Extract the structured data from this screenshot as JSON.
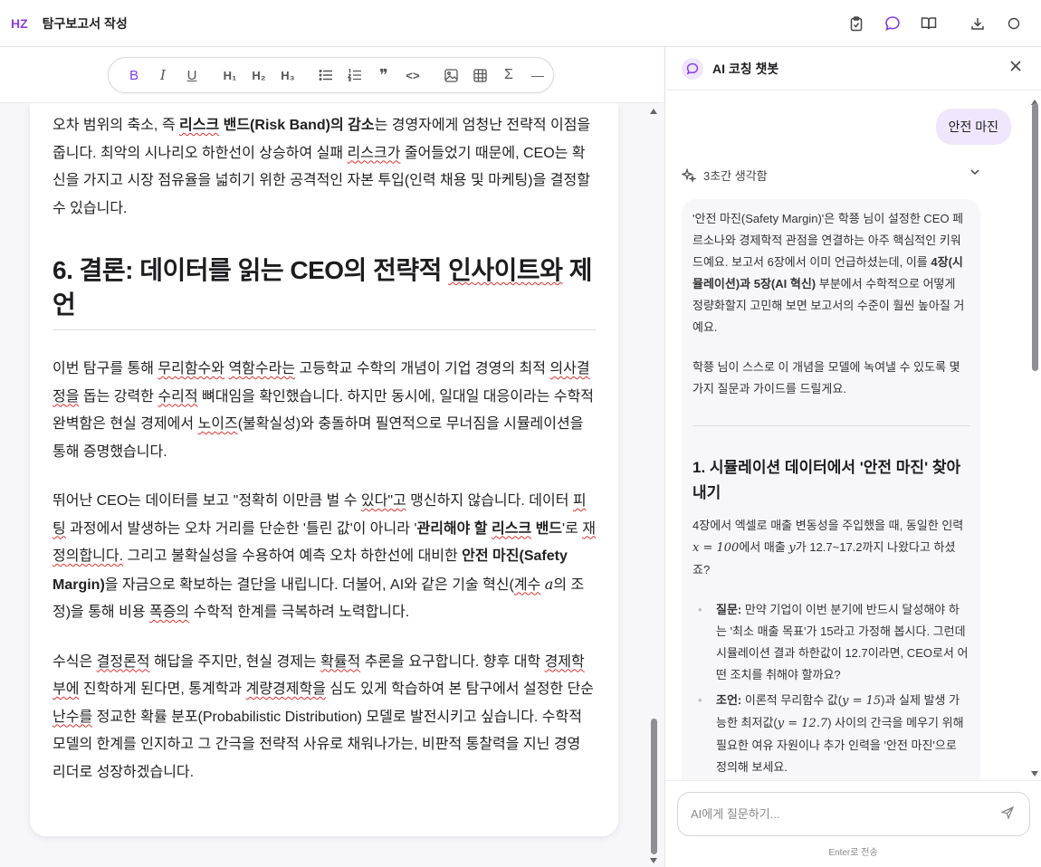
{
  "app": {
    "logo": "HZ",
    "title": "탐구보고서 작성"
  },
  "top_actions": [
    "clipboard-check-icon",
    "chat-bubble-icon",
    "book-open-icon",
    "download-icon",
    "circle-icon"
  ],
  "toolbar": {
    "bold": "B",
    "italic": "I",
    "underline": "U",
    "h1": "H₁",
    "h2": "H₂",
    "h3": "H₃",
    "quote": "❞",
    "code": "<>",
    "sigma": "Σ",
    "hr": "—"
  },
  "doc": {
    "p1": {
      "a": "오차 범위의 축소, 즉 ",
      "b_risk": "리스크",
      "b_band": " 밴드(Risk Band)의 감소",
      "c": "는 경영자에게 엄청난 전략적 이점을 줍니다. 최악의 시나리오 하한선이 상승하여 실패 ",
      "sq1": "리스크가",
      "d": " 줄어들었기 때문에, CEO는 확신을 가지고 시장 점유율을 넓히기 위한 공격적인 자본 투입(인력 채용 및 마케팅)을 결정할 수 있습니다."
    },
    "h6": {
      "a": "6. 결론: 데이터를 읽는 CEO의 전략적 ",
      "sq": "인사이트와",
      "b": " 제언"
    },
    "p2": {
      "a": "이번 탐구를 통해 ",
      "sq1": "무리함수와",
      "b": " ",
      "sq2": "역함수라는",
      "c": " 고등학교 수학의 개념이 기업 경영의 최적 ",
      "sq3": "의사결정을",
      "d": " 돕는 강력한 ",
      "sq4": "수리적",
      "e": " 뼈대임을 확인했습니다. 하지만 동시에, 일대일 대응이라는 수학적 완벽함은 현실 경제에서 ",
      "sq5": "노이즈",
      "f": "(불확실성)와 충돌하며 필연적으로 무너짐을 시뮬레이션을 통해 증명했습니다."
    },
    "p3": {
      "a": "뛰어난 CEO는 데이터를 보고 \"정확히 이만큼 벌 수 ",
      "sq1": "있다\"고",
      "b": " 맹신하지 않습니다. 데이터 ",
      "sq2": "피팅",
      "c": " 과정에서 발생하는 오차 거리를 단순한 '틀린 값'이 아니라 '",
      "b_manage": "관리해야 할 ",
      "b_risk": "리스크",
      "b_band": " 밴드",
      "d": "'로 ",
      "sq3": "재정의합니다.",
      "e": " 그리고 불확실성을 수용하여 예측 오차 하한선에 대비한 ",
      "b_safety": "안전 마진(Safety Margin)",
      "f": "을 자금으로 확보하는 결단을 내립니다. 더불어, AI와 같은 기술 혁신(",
      "sq4": "계수",
      "math": "a",
      "g": "의 조정)을 통해 비용 ",
      "sq5": "폭증의",
      "h": " 수학적 한계를 극복하려 노력합니다."
    },
    "p4": {
      "a": "수식은 ",
      "sq1": "결정론적",
      "b": " 해답을 주지만, 현실 경제는 ",
      "sq2": "확률적",
      "c": " 추론을 요구합니다. 향후 대학 ",
      "sq3": "경제학부에",
      "d": " 진학하게 된다면, 통계학과 ",
      "sq4": "계량경제학을",
      "e": " 심도 있게 학습하여 본 탐구에서 설정한 단순 ",
      "sq5": "난수를",
      "f": " 정교한 확률 분포(Probabilistic Distribution) 모델로 발전시키고 싶습니다. 수학적 모델의 한계를 인지하고 그 간극을 전략적 사유로 채워나가는, 비판적 통찰력을 지닌 경영 리더로 성장하겠습니다."
    }
  },
  "chat": {
    "title": "AI 코칭 챗봇",
    "user_message": "안전 마진",
    "thinking_label": "3초간 생각함",
    "intro": {
      "a": "'안전 마진(Safety Margin)'은 학쭁 님이 설정한 CEO 페르소나와 경제학적 관점을 연결하는 아주 핵심적인 키워드예요. 보고서 6장에서 이미 언급하셨는데, 이를 ",
      "b": "4장(시뮬레이션)과 5장(AI 혁신)",
      "c": " 부분에서 수학적으로 어떻게 정량화할지 고민해 보면 보고서의 수준이 훨씬 높아질 거예요."
    },
    "intro2": "학쭁 님이 스스로 이 개념을 모델에 녹여낼 수 있도록 몇 가지 질문과 가이드를 드릴게요.",
    "section1_title": "1. 시뮬레이션 데이터에서 '안전 마진' 찾아내기",
    "section1_body": {
      "a": "4장에서 엑셀로 매출 변동성을 주입했을 때, 동일한 인력 ",
      "m1": "x = 100",
      "b": "에서 매출 ",
      "m2": "y",
      "c": "가 12.7~17.2까지 나왔다고 하셨죠?"
    },
    "bullets": [
      {
        "label": "질문:",
        "text": " 만약 기업이 이번 분기에 반드시 달성해야 하는 '최소 매출 목표'가 15라고 가정해 봅시다. 그런데 시뮬레이션 결과 하한값이 12.7이라면, CEO로서 어떤 조치를 취해야 할까요?"
      },
      {
        "label": "조언:",
        "text_a": " 이론적 무리함수 값(",
        "m1": "y = 15",
        "text_b": ")과 실제 발생 가능한 최저값(",
        "m2": "y = 12.7",
        "text_c": ") 사이의 간극을 메우기 위해 필요한 여유 자원이나 추가 인력을 '안전 마진'으로 정의해 보세요."
      }
    ],
    "input_placeholder": "AI에게 질문하기...",
    "hint": "Enter로 전송"
  }
}
